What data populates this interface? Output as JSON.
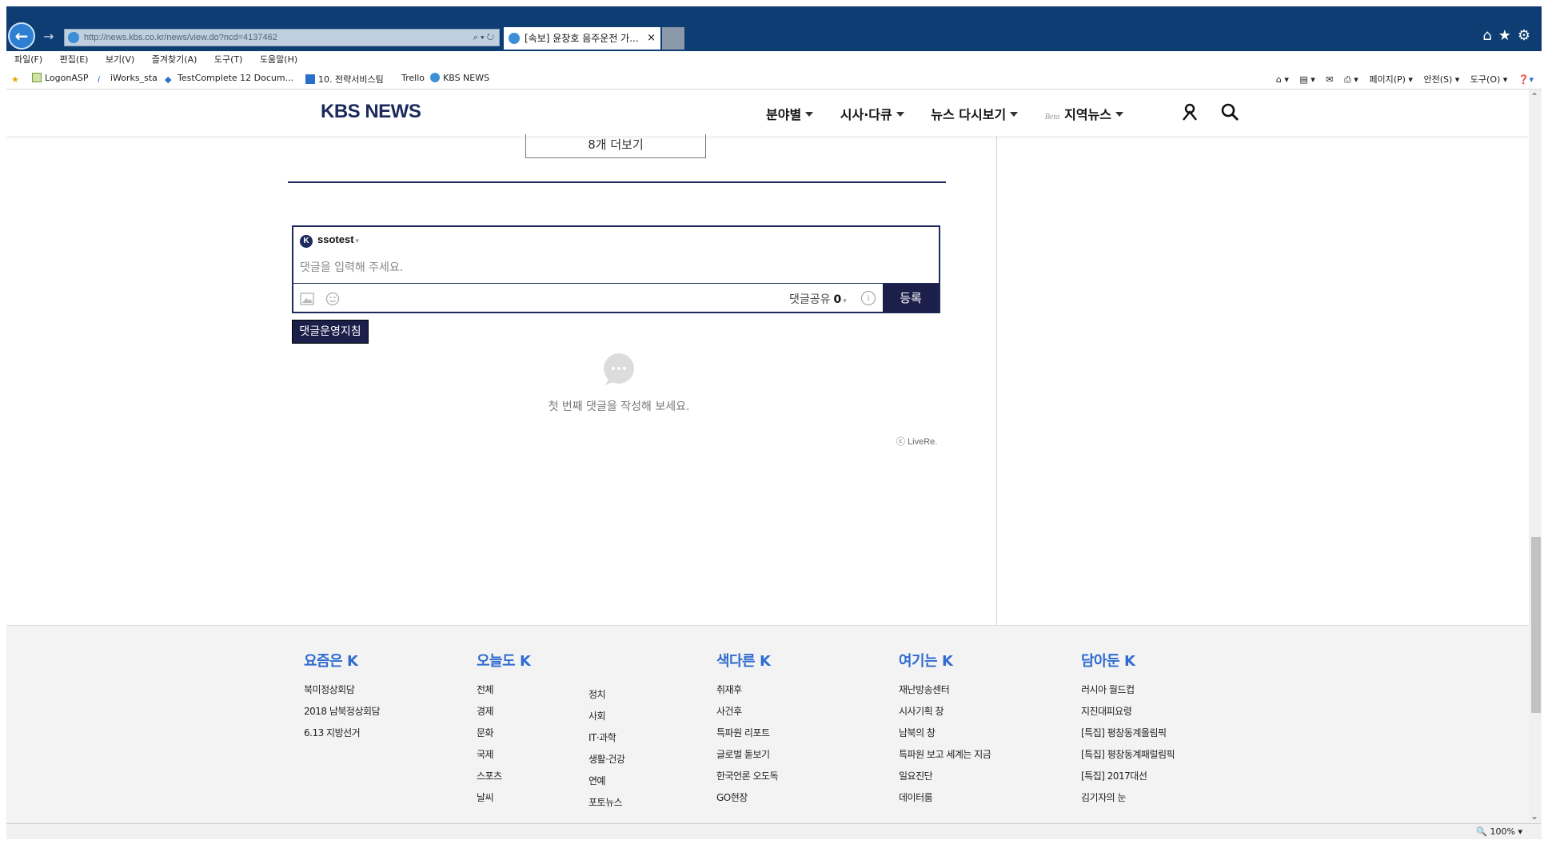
{
  "browser": {
    "address": "http://news.kbs.co.kr/news/view.do?ncd=4137462",
    "tab_title": "[속보] 윤창호 음주운전 가...",
    "tab_close": "×",
    "menu": [
      "파일(F)",
      "편집(E)",
      "보기(V)",
      "즐겨찾기(A)",
      "도구(T)",
      "도움말(H)"
    ],
    "favorites": [
      "LogonASP",
      "iWorks_sta",
      "TestComplete 12 Docum...",
      "10. 전략서비스팀",
      "Trello",
      "KBS NEWS"
    ],
    "commands": [
      "페이지(P) ▾",
      "안전(S) ▾",
      "도구(O) ▾"
    ],
    "zoom": "100%"
  },
  "site": {
    "logo": "KBS NEWS",
    "nav": [
      {
        "label": "분야별"
      },
      {
        "label": "시사·다큐"
      },
      {
        "label": "뉴스 다시보기"
      },
      {
        "label": "지역뉴스",
        "badge": "Beta"
      }
    ]
  },
  "article": {
    "more_button": "8개 더보기"
  },
  "comments": {
    "username": "ssotest",
    "user_badge": "K",
    "placeholder": "댓글을 입력해 주세요.",
    "share_label": "댓글공유",
    "share_count": "0",
    "info_symbol": "i",
    "register_button": "등록",
    "policy_button": "댓글운영지침",
    "empty_message": "첫 번째 댓글을 작성해 보세요.",
    "powered_by": "ⓒ LiveRe."
  },
  "footer": {
    "columns": [
      {
        "title": "요즘은 K",
        "items": [
          "북미정상회담",
          "2018 남북정상회담",
          "6.13 지방선거"
        ]
      },
      {
        "title": "오늘도 K",
        "items": [
          "전체",
          "경제",
          "문화",
          "국제",
          "스포츠",
          "날씨"
        ],
        "items2": [
          "정치",
          "사회",
          "IT·과학",
          "생활·건강",
          "연예",
          "포토뉴스"
        ]
      },
      {
        "title": "색다른 K",
        "items": [
          "취재후",
          "사건후",
          "특파원 리포트",
          "글로벌 돋보기",
          "한국언론 오도독",
          "GO현장"
        ]
      },
      {
        "title": "여기는 K",
        "items": [
          "재난방송센터",
          "시사기획 창",
          "남북의 창",
          "특파원 보고 세계는 지금",
          "일요진단",
          "데이터룸"
        ]
      },
      {
        "title": "담아둔 K",
        "items": [
          "러시아 월드컵",
          "지진대피요령",
          "[특집] 평창동계올림픽",
          "[특집] 평창동계패럴림픽",
          "[특집] 2017대선",
          "김기자의 눈"
        ]
      }
    ]
  },
  "colors": {
    "chrome": "#0e3d74",
    "brand_navy": "#1c2a5c",
    "footer_title": "#2f6bd1"
  }
}
